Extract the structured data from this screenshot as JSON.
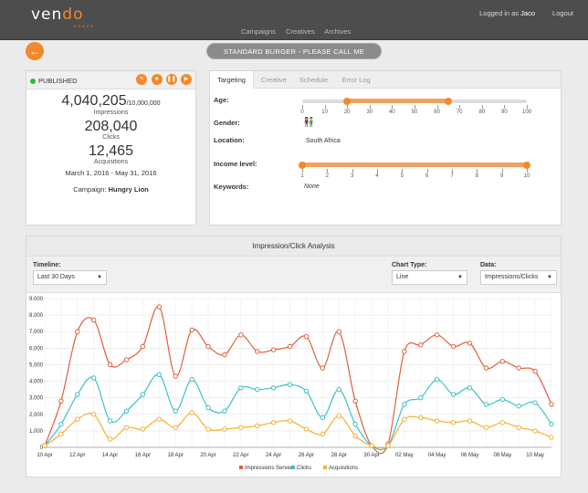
{
  "brand": {
    "word_a": "ven",
    "word_b": "do",
    "sub": "SPACE"
  },
  "user": {
    "logged_prefix": "Logged in as",
    "name": "Jaco",
    "logout": "Logout"
  },
  "nav": [
    "Campaigns",
    "Creatives",
    "Archives"
  ],
  "title": "STANDARD BURGER - PLEASE CALL ME",
  "stats": {
    "status": "PUBLISHED",
    "impressions": "4,040,205",
    "impressions_cap": "/10,000,000",
    "impressions_label": "Impressions",
    "clicks": "208,040",
    "clicks_label": "Clicks",
    "acquisitions": "12,465",
    "acquisitions_label": "Acquisitions",
    "dates": "March 1, 2016 - May 31, 2016",
    "campaign_prefix": "Campaign:",
    "campaign_name": "Hungry Lion",
    "controls": [
      "edit-icon",
      "stop-icon",
      "pause-icon",
      "play-icon"
    ]
  },
  "targeting": {
    "tabs": [
      "Targeting",
      "Creative",
      "Schedule",
      "Error Log"
    ],
    "age_label": "Age:",
    "age_ticks": [
      "0",
      "10",
      "20",
      "30",
      "40",
      "50",
      "60",
      "70",
      "80",
      "90",
      "100"
    ],
    "age_range": [
      20,
      65
    ],
    "gender_label": "Gender:",
    "location_label": "Location:",
    "location": "South Africa",
    "income_label": "Income level:",
    "income_ticks": [
      "1",
      "2",
      "3",
      "4",
      "5",
      "6",
      "7",
      "8",
      "9",
      "10"
    ],
    "income_range": [
      1,
      10
    ],
    "keywords_label": "Keywords:",
    "keywords": "None"
  },
  "analysis": {
    "title": "Impression/Click Analysis",
    "timeline_label": "Timeline:",
    "timeline_value": "Last 30 Days",
    "charttype_label": "Chart Type:",
    "charttype_value": "Line",
    "data_label": "Data:",
    "data_value": "Impressions/Clicks"
  },
  "colors": {
    "accent": "#f28a2a",
    "impressions": "#e0603c",
    "clicks": "#3cc0c8",
    "acquisitions": "#f5b030"
  },
  "chart_data": {
    "type": "line",
    "x": [
      "10 Apr",
      "11 Apr",
      "12 Apr",
      "13 Apr",
      "14 Apr",
      "15 Apr",
      "16 Apr",
      "17 Apr",
      "18 Apr",
      "19 Apr",
      "20 Apr",
      "21 Apr",
      "22 Apr",
      "23 Apr",
      "24 Apr",
      "25 Apr",
      "26 Apr",
      "27 Apr",
      "28 Apr",
      "29 Apr",
      "30 Apr",
      "1 May",
      "2 May",
      "3 May",
      "4 May",
      "5 May",
      "6 May",
      "7 May",
      "8 May",
      "9 May",
      "10 May",
      "11 May"
    ],
    "x_tick_labels": [
      "10 Apr",
      "12 Apr",
      "14 Apr",
      "16 Apr",
      "18 Apr",
      "20 Apr",
      "22 Apr",
      "24 Apr",
      "26 Apr",
      "28 Apr",
      "30 Apr",
      "02 May",
      "04 May",
      "06 May",
      "08 May",
      "10 May"
    ],
    "y_tick_labels": [
      "0",
      "1,000",
      "2,000",
      "3,000",
      "4,000",
      "5,000",
      "6,000",
      "7,000",
      "8,000",
      "9,000"
    ],
    "ylim": [
      0,
      9000
    ],
    "series": [
      {
        "name": "Impressions Served",
        "values": [
          100,
          2800,
          7000,
          7700,
          5000,
          5300,
          6100,
          8500,
          4300,
          7100,
          6100,
          5600,
          6800,
          5800,
          5900,
          6100,
          6700,
          4800,
          7000,
          2800,
          100,
          200,
          5800,
          6200,
          6800,
          6100,
          6300,
          4800,
          5200,
          4800,
          4600,
          2600
        ]
      },
      {
        "name": "Clicks",
        "values": [
          100,
          1400,
          3200,
          4200,
          1600,
          2200,
          3200,
          4400,
          2200,
          4100,
          2400,
          2200,
          3600,
          3500,
          3600,
          3800,
          3400,
          1800,
          3500,
          1400,
          100,
          100,
          2600,
          3000,
          4100,
          3200,
          3600,
          2600,
          2900,
          2500,
          2700,
          1400
        ]
      },
      {
        "name": "Acquisitions",
        "values": [
          100,
          800,
          1700,
          2000,
          500,
          1200,
          1100,
          1700,
          1200,
          2100,
          1100,
          1100,
          1200,
          1300,
          1500,
          1600,
          1100,
          800,
          1900,
          700,
          100,
          100,
          1700,
          1800,
          1600,
          1500,
          1600,
          1200,
          1500,
          1200,
          1000,
          600
        ]
      }
    ],
    "legend_position": "bottom-center",
    "grid": true
  }
}
